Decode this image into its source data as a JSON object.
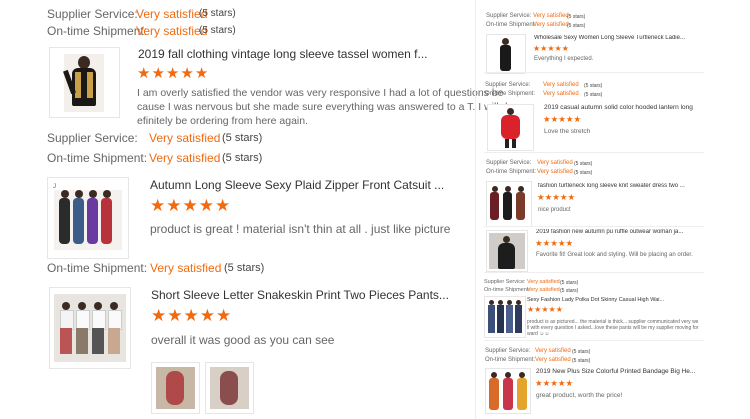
{
  "left": {
    "top_ratings": [
      {
        "label": "Supplier Service:",
        "value": "Very satisfied",
        "stars": "(5 stars)"
      },
      {
        "label": "On-time Shipment:",
        "value": "Very satisfied",
        "stars": "(5 stars)"
      }
    ],
    "reviews": [
      {
        "title": "2019 fall clothing vintage long sleeve tassel women f...",
        "rating": 5,
        "text_lines": [
          "I am overly satisfied the vendor was very responsive I had a lot of questions be",
          "cause I was nervous but she made sure everything was answered to a T. I will d",
          "efinitely be ordering from here again."
        ],
        "ratings": [
          {
            "label": "Supplier Service:",
            "value": "Very satisfied",
            "stars": "(5 stars)"
          },
          {
            "label": "On-time Shipment:",
            "value": "Very satisfied",
            "stars": "(5 stars)"
          }
        ]
      },
      {
        "title": "Autumn Long Sleeve Sexy Plaid Zipper Front Catsuit ...",
        "rating": 5,
        "text_lines": [
          "product is great ! material isn't thin at all . just like picture"
        ],
        "ratings": [
          {
            "label": "On-time Shipment:",
            "value": "Very satisfied",
            "stars": "(5 stars)"
          }
        ]
      },
      {
        "title": "Short Sleeve Letter Snakeskin Print Two Pieces Pants...",
        "rating": 5,
        "text_lines": [
          "overall it was good as you can see"
        ]
      }
    ]
  },
  "right": {
    "items": [
      {
        "ratings": [
          {
            "label": "Supplier Service:",
            "value": "Very satisfied",
            "stars": "(5 stars)"
          },
          {
            "label": "On-time Shipment:",
            "value": "Very satisfied",
            "stars": "(5 stars)"
          }
        ],
        "title": "Wholesale Sexy Women Long Sleeve Turtleneck Ladie...",
        "rating": 5,
        "text": "Everything I expected."
      },
      {
        "ratings": [
          {
            "label": "Supplier Service:",
            "value": "Very satisfied",
            "stars": "(5 stars)"
          },
          {
            "label": "On-time Shipment:",
            "value": "Very satisfied",
            "stars": "(5 stars)"
          }
        ],
        "title": "2019 casual autumn solid color hooded lantern long s...",
        "rating": 5,
        "text": "Love the stretch"
      },
      {
        "ratings": [
          {
            "label": "Supplier Service:",
            "value": "Very satisfied",
            "stars": "(5 stars)"
          },
          {
            "label": "On-time Shipment:",
            "value": "Very satisfied",
            "stars": "(5 stars)"
          }
        ],
        "title": "fashion turtleneck long sleeve knit sweater dress two ...",
        "rating": 5,
        "text": "nice product"
      },
      {
        "ratings": [],
        "title": "2019 fashion new autumn pu ruffle outwear woman ja...",
        "rating": 5,
        "text": "Favorite fit! Great look and styling. Will be placing an order."
      },
      {
        "ratings": [
          {
            "label": "Supplier Service:",
            "value": "Very satisfied",
            "stars": "(5 stars)"
          },
          {
            "label": "On-time Shipment:",
            "value": "Very satisfied",
            "stars": "(5 stars)"
          }
        ],
        "title": "Sexy Fashion Lady Polka Dot Skinny Casual High Wai...",
        "rating": 5,
        "text_lines": [
          "product is as pictured... the material is thick... supplier communicated very we",
          "ll with every question I asked...love these pants will be my supplier moving for",
          "ward ☺☺"
        ]
      },
      {
        "ratings": [
          {
            "label": "Supplier Service:",
            "value": "Very satisfied",
            "stars": "(5 stars)"
          },
          {
            "label": "On-time Shipment:",
            "value": "Very satisfied",
            "stars": "(5 stars)"
          }
        ],
        "title": "2019 New Plus Size Colorful Printed Bandage Big He...",
        "rating": 5,
        "text": "great product, worth the price!"
      }
    ]
  }
}
